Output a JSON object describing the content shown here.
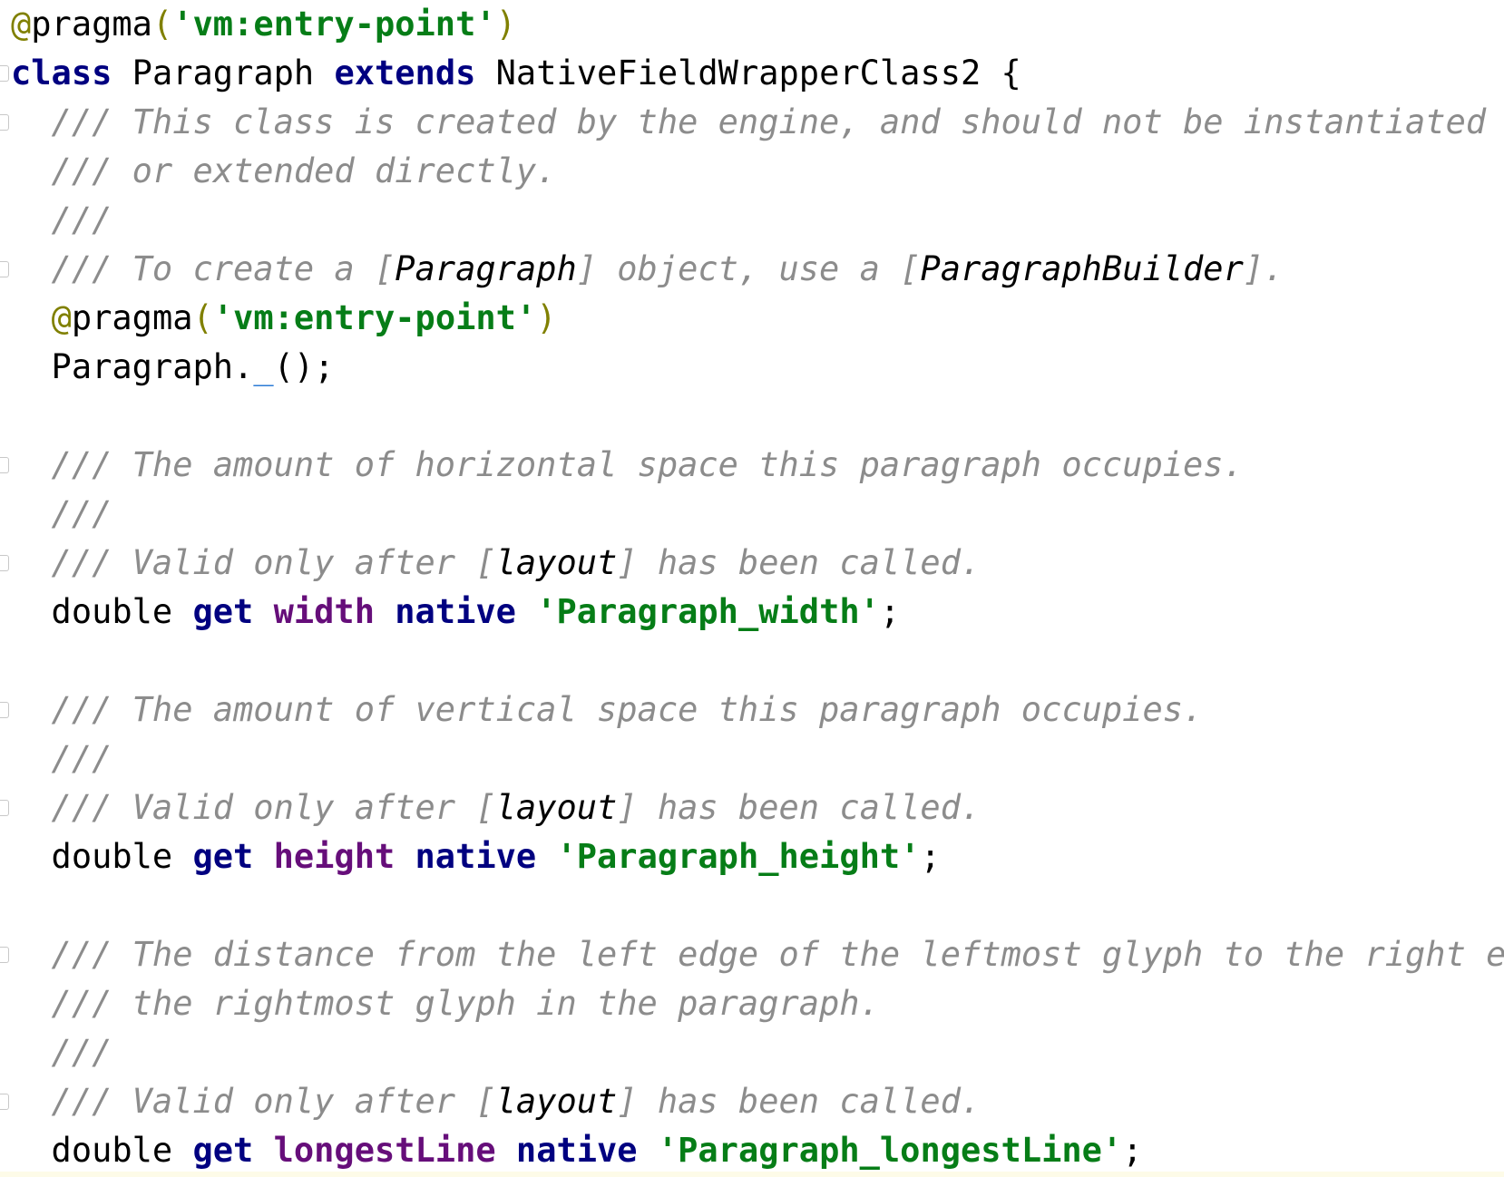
{
  "editor": {
    "lines": [
      {
        "tokens": [
          {
            "t": "@",
            "c": "tok-annotation"
          },
          {
            "t": "pragma",
            "c": "tok-ident"
          },
          {
            "t": "(",
            "c": "tok-annotation"
          },
          {
            "t": "'vm:entry-point'",
            "c": "tok-string"
          },
          {
            "t": ")",
            "c": "tok-annotation"
          }
        ]
      },
      {
        "tokens": [
          {
            "t": "class",
            "c": "tok-keyword"
          },
          {
            "t": " Paragraph ",
            "c": "tok-ident"
          },
          {
            "t": "extends",
            "c": "tok-keyword"
          },
          {
            "t": " NativeFieldWrapperClass2 {",
            "c": "tok-ident"
          }
        ]
      },
      {
        "tokens": [
          {
            "t": "  /// This class is created by the engine, and should not be instantiated",
            "c": "tok-comment"
          }
        ]
      },
      {
        "tokens": [
          {
            "t": "  /// or extended directly.",
            "c": "tok-comment"
          }
        ]
      },
      {
        "tokens": [
          {
            "t": "  ///",
            "c": "tok-comment"
          }
        ]
      },
      {
        "tokens": [
          {
            "t": "  /// To create a [",
            "c": "tok-comment"
          },
          {
            "t": "Paragraph",
            "c": "tok-comment-ref"
          },
          {
            "t": "] object, use a [",
            "c": "tok-comment"
          },
          {
            "t": "ParagraphBuilder",
            "c": "tok-comment-ref"
          },
          {
            "t": "].",
            "c": "tok-comment"
          }
        ]
      },
      {
        "tokens": [
          {
            "t": "  ",
            "c": "tok-ident"
          },
          {
            "t": "@",
            "c": "tok-annotation"
          },
          {
            "t": "pragma",
            "c": "tok-ident"
          },
          {
            "t": "(",
            "c": "tok-annotation"
          },
          {
            "t": "'vm:entry-point'",
            "c": "tok-string"
          },
          {
            "t": ")",
            "c": "tok-annotation"
          }
        ]
      },
      {
        "tokens": [
          {
            "t": "  Paragraph.",
            "c": "tok-ident"
          },
          {
            "t": "_",
            "c": "tok-private"
          },
          {
            "t": "();",
            "c": "tok-ident"
          }
        ]
      },
      {
        "tokens": []
      },
      {
        "tokens": [
          {
            "t": "  /// The amount of horizontal space this paragraph occupies.",
            "c": "tok-comment"
          }
        ]
      },
      {
        "tokens": [
          {
            "t": "  ///",
            "c": "tok-comment"
          }
        ]
      },
      {
        "tokens": [
          {
            "t": "  /// Valid only after [",
            "c": "tok-comment"
          },
          {
            "t": "layout",
            "c": "tok-comment-ref"
          },
          {
            "t": "] has been called.",
            "c": "tok-comment"
          }
        ]
      },
      {
        "tokens": [
          {
            "t": "  double ",
            "c": "tok-ident"
          },
          {
            "t": "get",
            "c": "tok-keyword"
          },
          {
            "t": " ",
            "c": "tok-ident"
          },
          {
            "t": "width",
            "c": "tok-field"
          },
          {
            "t": " ",
            "c": "tok-ident"
          },
          {
            "t": "native",
            "c": "tok-keyword"
          },
          {
            "t": " ",
            "c": "tok-ident"
          },
          {
            "t": "'Paragraph_width'",
            "c": "tok-string"
          },
          {
            "t": ";",
            "c": "tok-ident"
          }
        ]
      },
      {
        "tokens": []
      },
      {
        "tokens": [
          {
            "t": "  /// The amount of vertical space this paragraph occupies.",
            "c": "tok-comment"
          }
        ]
      },
      {
        "tokens": [
          {
            "t": "  ///",
            "c": "tok-comment"
          }
        ]
      },
      {
        "tokens": [
          {
            "t": "  /// Valid only after [",
            "c": "tok-comment"
          },
          {
            "t": "layout",
            "c": "tok-comment-ref"
          },
          {
            "t": "] has been called.",
            "c": "tok-comment"
          }
        ]
      },
      {
        "tokens": [
          {
            "t": "  double ",
            "c": "tok-ident"
          },
          {
            "t": "get",
            "c": "tok-keyword"
          },
          {
            "t": " ",
            "c": "tok-ident"
          },
          {
            "t": "height",
            "c": "tok-field"
          },
          {
            "t": " ",
            "c": "tok-ident"
          },
          {
            "t": "native",
            "c": "tok-keyword"
          },
          {
            "t": " ",
            "c": "tok-ident"
          },
          {
            "t": "'Paragraph_height'",
            "c": "tok-string"
          },
          {
            "t": ";",
            "c": "tok-ident"
          }
        ]
      },
      {
        "tokens": []
      },
      {
        "tokens": [
          {
            "t": "  /// The distance from the left edge of the leftmost glyph to the right ed",
            "c": "tok-comment"
          }
        ]
      },
      {
        "tokens": [
          {
            "t": "  /// the rightmost glyph in the paragraph.",
            "c": "tok-comment"
          }
        ]
      },
      {
        "tokens": [
          {
            "t": "  ///",
            "c": "tok-comment"
          }
        ]
      },
      {
        "tokens": [
          {
            "t": "  /// Valid only after [",
            "c": "tok-comment"
          },
          {
            "t": "layout",
            "c": "tok-comment-ref"
          },
          {
            "t": "] has been called.",
            "c": "tok-comment"
          }
        ]
      },
      {
        "tokens": [
          {
            "t": "  double ",
            "c": "tok-ident"
          },
          {
            "t": "get",
            "c": "tok-keyword"
          },
          {
            "t": " ",
            "c": "tok-ident"
          },
          {
            "t": "longestLine",
            "c": "tok-field"
          },
          {
            "t": " ",
            "c": "tok-ident"
          },
          {
            "t": "native",
            "c": "tok-keyword"
          },
          {
            "t": " ",
            "c": "tok-ident"
          },
          {
            "t": "'Paragraph_longestLine'",
            "c": "tok-string"
          },
          {
            "t": ";",
            "c": "tok-ident"
          }
        ]
      }
    ],
    "fold_markers": [
      "fold-marker-class",
      "fold-marker-doc-1",
      "fold-marker-doc-1-end",
      "fold-marker-doc-2",
      "fold-marker-doc-2-end",
      "fold-marker-doc-3",
      "fold-marker-doc-3-end",
      "fold-marker-doc-4",
      "fold-marker-doc-4-end"
    ]
  },
  "colors": {
    "background": "#ffffff",
    "annotation": "#808000",
    "keyword": "#000080",
    "string": "#067d17",
    "comment": "#8c8c8c",
    "field": "#660e7a",
    "private": "#2b7bd6"
  }
}
